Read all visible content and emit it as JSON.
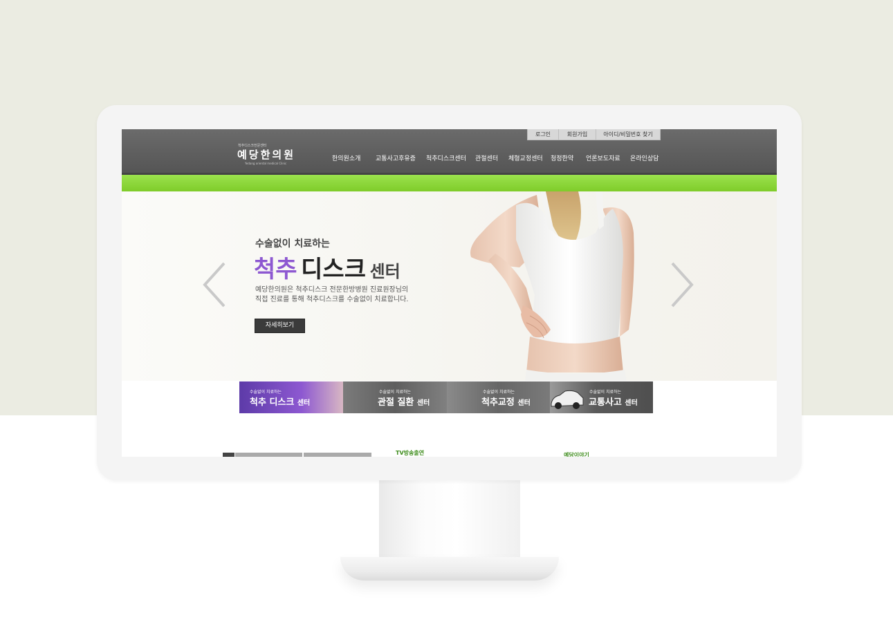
{
  "top_links": [
    "로그인",
    "회원가입",
    "아이디/비밀번호 찾기"
  ],
  "logo": {
    "small": "척추디스크전문센터",
    "main": "예당한의원",
    "sub": "Yedang oriental medical Clinic"
  },
  "main_nav": [
    "한의원소개",
    "교통사고후유증",
    "척추디스크센터",
    "관절센터",
    "체형교정센터",
    "청정한약",
    "언론보도자료",
    "온라인상담"
  ],
  "hero": {
    "small": "수술없이 치료하는",
    "big_part1": "척추",
    "big_part2": "디스크",
    "big_part3": "센터",
    "desc_line1": "예당한의원은 척추디스크 전문한방병원 진료원장님의",
    "desc_line2": "직접 진료를 통해 척추디스크를 수술없이 치료합니다.",
    "button": "자세히보기"
  },
  "center_tabs": [
    {
      "small": "수술없이 치료하는",
      "big": "척추 디스크",
      "suffix": "센터"
    },
    {
      "small": "수술없이 치료하는",
      "big": "관절 질환",
      "suffix": "센터"
    },
    {
      "small": "수술없이 치료하는",
      "big": "척추교정",
      "suffix": "센터"
    },
    {
      "small": "수술없이 치료하는",
      "big": "교통사고",
      "suffix": "센터"
    }
  ],
  "below": {
    "tv_label": "TV방송출연",
    "story_label": "예당이야기"
  },
  "colors": {
    "page_bg_top": "#ebece2",
    "header": "#5f5f5f",
    "green_bar": "#8bd63a",
    "hero_accent": "#8d58d1",
    "section_label": "#3f8d1d"
  }
}
